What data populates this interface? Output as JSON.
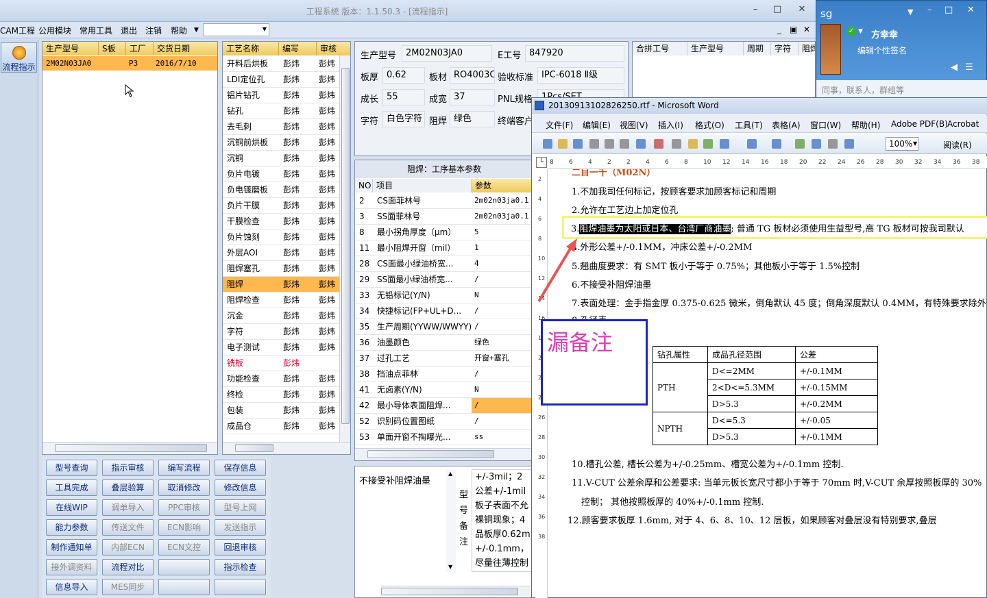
{
  "app": {
    "title": "工程系统  版本：1.1.50.3 - [流程指示]"
  },
  "menu": [
    "CAM工程",
    "公用模块",
    "常用工具",
    "退出",
    "注销",
    "帮助"
  ],
  "left_button": "流程指示",
  "order_grid": {
    "headers": [
      "生产型号",
      "S板",
      "工厂",
      "交货日期"
    ],
    "rows": [
      [
        "2M02N03JA0",
        "",
        "P3",
        "2016/7/10"
      ]
    ]
  },
  "process_grid": {
    "headers": [
      "工艺名称",
      "编写",
      "审核"
    ],
    "rows": [
      [
        "开料后烘板",
        "彭炜",
        "彭炜"
      ],
      [
        "LDI定位孔",
        "彭炜",
        "彭炜"
      ],
      [
        "铝片钻孔",
        "彭炜",
        "彭炜"
      ],
      [
        "钻孔",
        "彭炜",
        "彭炜"
      ],
      [
        "去毛刺",
        "彭炜",
        "彭炜"
      ],
      [
        "沉铜前烘板",
        "彭炜",
        "彭炜"
      ],
      [
        "沉铜",
        "彭炜",
        "彭炜"
      ],
      [
        "负片电镀",
        "彭炜",
        "彭炜"
      ],
      [
        "负电镀磨板",
        "彭炜",
        "彭炜"
      ],
      [
        "负片干膜",
        "彭炜",
        "彭炜"
      ],
      [
        "干膜检查",
        "彭炜",
        "彭炜"
      ],
      [
        "负片蚀刻",
        "彭炜",
        "彭炜"
      ],
      [
        "外层AOI",
        "彭炜",
        "彭炜"
      ],
      [
        "阻焊塞孔",
        "彭炜",
        "彭炜"
      ],
      [
        "阻焊",
        "彭炜",
        "彭炜"
      ],
      [
        "阻焊检查",
        "彭炜",
        "彭炜"
      ],
      [
        "沉金",
        "彭炜",
        "彭炜"
      ],
      [
        "字符",
        "彭炜",
        "彭炜"
      ],
      [
        "电子测试",
        "彭炜",
        "彭炜"
      ],
      [
        "铣板",
        "彭炜",
        ""
      ],
      [
        "功能检查",
        "彭炜",
        "彭炜"
      ],
      [
        "终检",
        "彭炜",
        "彭炜"
      ],
      [
        "包装",
        "彭炜",
        "彭炜"
      ],
      [
        "成品仓",
        "彭炜",
        "彭炜"
      ]
    ]
  },
  "info": {
    "model_label": "生产型号",
    "model": "2M02N03JA0",
    "eno_label": "E工号",
    "eno": "847920",
    "thick_label": "板厚",
    "thick": "0.62",
    "mat_label": "板材",
    "mat": "RO4003C",
    "std_label": "验收标准",
    "std": "IPC-6018 Ⅱ级",
    "len_label": "成长",
    "len": "55",
    "wid_label": "成宽",
    "wid": "37",
    "pnl_label": "PNL规格",
    "pnl": "1Pcs/SET",
    "char_label": "字符",
    "char": "白色字符",
    "mask_label": "阻焊",
    "mask": "绿色",
    "cust_label": "终端客户"
  },
  "merge_grid": {
    "headers": [
      "合拼工号",
      "生产型号",
      "周期",
      "字符",
      "阻焊"
    ]
  },
  "params": {
    "title": "阻焊：工序基本参数",
    "headers": [
      "NO",
      "项目",
      "参数"
    ],
    "rows": [
      [
        "2",
        "CS面菲林号",
        "2m02n03ja0.1"
      ],
      [
        "3",
        "SS面菲林号",
        "2m02n03ja0.1"
      ],
      [
        "8",
        "最小拐角厚度（μm）",
        "5"
      ],
      [
        "11",
        "最小阻焊开窗（mil）",
        "1"
      ],
      [
        "28",
        "CS面最小绿油桥宽...",
        "4"
      ],
      [
        "29",
        "SS面最小绿油桥宽...",
        "/"
      ],
      [
        "33",
        "无铅标记(Y/N)",
        "N"
      ],
      [
        "34",
        "快捷标记(FP+UL+D...",
        "/"
      ],
      [
        "35",
        "生产周期(YYWW/WWYY)",
        "/"
      ],
      [
        "36",
        "油墨颜色",
        "绿色"
      ],
      [
        "37",
        "过孔工艺",
        "开窗+塞孔"
      ],
      [
        "38",
        "挡油点菲林",
        "/"
      ],
      [
        "41",
        "无卤素(Y/N)",
        "N"
      ],
      [
        "42",
        "最小导体表面阻焊...",
        "/"
      ],
      [
        "52",
        "识别码位置图纸",
        "/"
      ],
      [
        "53",
        "单面开窗不掏曝光...",
        "ss"
      ]
    ]
  },
  "note": {
    "text": "不接受补阻焊油墨",
    "label": [
      "型",
      "号",
      "备",
      "注"
    ],
    "lines": [
      "+/-3mil；2",
      "公差+/-1mil",
      "板子表面不允",
      "裸铜现象；4",
      "品板厚0.62m",
      "+/-0.1mm，",
      "尽量往薄控制"
    ]
  },
  "buttons": [
    [
      "型号查询",
      "指示审核",
      "编写流程",
      "保存信息"
    ],
    [
      "工具完成",
      "叠层验算",
      "取消修改",
      "修改信息"
    ],
    [
      "在线WIP",
      "调单导入",
      "PPC审核",
      "型号上网"
    ],
    [
      "能力参数",
      "传送文件",
      "ECN影响",
      "发送指示"
    ],
    [
      "制作通知单",
      "内部ECN",
      "ECN文控",
      "回退审核"
    ],
    [
      "接外调资料",
      "流程对比",
      "",
      "指示检查"
    ],
    [
      "信息导入",
      "MES同步",
      "",
      ""
    ]
  ],
  "buttons_disabled": [
    [
      false,
      false,
      false,
      false
    ],
    [
      false,
      false,
      false,
      false
    ],
    [
      false,
      true,
      true,
      true
    ],
    [
      false,
      true,
      true,
      true
    ],
    [
      false,
      true,
      true,
      false
    ],
    [
      true,
      false,
      false,
      false
    ],
    [
      false,
      true,
      false,
      false
    ]
  ],
  "word": {
    "title": "20130913102826250.rtf - Microsoft Word",
    "menu": [
      "文件(F)",
      "编辑(E)",
      "视图(V)",
      "插入(I)",
      "格式(O)",
      "工具(T)",
      "表格(A)",
      "窗口(W)",
      "帮助(H)",
      "Adobe PDF(B)",
      "Acrobat"
    ],
    "zoom": "100%",
    "read": "阅读(R)",
    "ruler": [
      "8",
      "6",
      "4",
      "2",
      "2",
      "4",
      "6",
      "8",
      "10",
      "12",
      "14",
      "16",
      "18",
      "20",
      "22",
      "24",
      "26",
      "28",
      "30",
      "32",
      "34",
      "36",
      "38",
      "40",
      "42"
    ],
    "lines": [
      "二目一千（M02N）",
      "1.不加我司任何标记，按顾客要求加顾客标记和周期",
      "2.允许在工艺边上加定位孔",
      "4.外形公差+/-0.1MM，冲床公差+/-0.2MM",
      "5.翘曲度要求：有 SMT 板小于等于 0.75%；其他板小于等于 1.5%控制",
      "6.不接受补阻焊油墨",
      "7.表面处理：金手指金厚 0.375-0.625 微米，倒角默认 45 度；倒角深度默认 0.4MM，有特殊要求除外",
      "8.孔径表",
      "10.槽孔公差, 槽长公差为+/-0.25mm、槽宽公差为+/-0.1mm 控制.",
      "11.V-CUT 公差余厚和公差要求: 当单元板长宽尺寸都小于等于 70mm 时,V-CUT 余厚按照板厚的 30%",
      "控制；  其他按照板厚的 40%+/-0.1mm 控制.",
      "12.顾客要求板厚  1.6mm, 对于  4、6、8、10、12 层板，如果顾客对叠层没有特别要求,叠层"
    ],
    "hl_prefix": "3.",
    "hl_sel": "阻焊油墨为太阳或日本、台湾厂商油墨",
    "hl_rest": "; 普通 TG 板材必须使用生益型号,高 TG 板材可按我司默认",
    "annotation": "漏备注",
    "table": {
      "headers": [
        "钻孔属性",
        "成品孔径范围",
        "公差"
      ],
      "pth": "PTH",
      "npth": "NPTH",
      "pth_rows": [
        [
          "D<=2MM",
          "+/-0.1MM"
        ],
        [
          "2<D<=5.3MM",
          "+/-0.15MM"
        ],
        [
          "D>5.3",
          "+/-0.2MM"
        ]
      ],
      "npth_rows": [
        [
          "D<=5.3",
          "+/-0.05"
        ],
        [
          "D>5.3",
          "+/-0.1MM"
        ]
      ]
    },
    "vruler": [
      "2",
      "4",
      "6",
      "8",
      "10",
      "12",
      "14",
      "16",
      "18",
      "20",
      "22",
      "24",
      "26",
      "28",
      "30",
      "32",
      "34",
      "36",
      "38"
    ]
  },
  "qq": {
    "title": "sg",
    "name": "方幸幸",
    "sig": "编辑个性签名",
    "search": "同事，联系人，群组等"
  },
  "colors": {
    "header": "#f0c95c",
    "accent": "#ffb84d",
    "red": "#e0002a",
    "annotation_border": "#1a22c8",
    "annotation_text": "#e23cb8",
    "highlight": "#f7f27a"
  }
}
